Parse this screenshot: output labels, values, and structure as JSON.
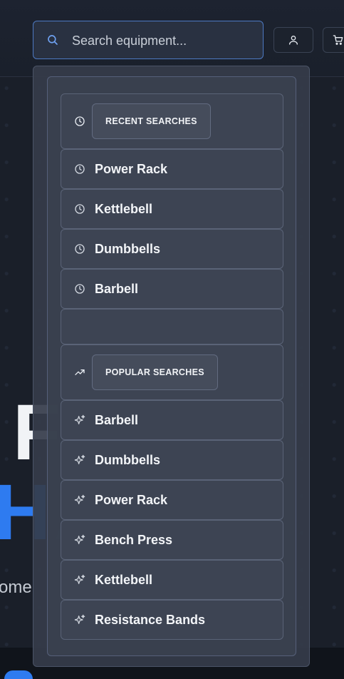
{
  "search": {
    "placeholder": "Search equipment..."
  },
  "hero": {
    "line1": "FT",
    "line2": "HA",
    "subtitle": "ome"
  },
  "recent": {
    "title": "RECENT SEARCHES",
    "items": [
      "Power Rack",
      "Kettlebell",
      "Dumbbells",
      "Barbell"
    ]
  },
  "popular": {
    "title": "POPULAR SEARCHES",
    "items": [
      "Barbell",
      "Dumbbells",
      "Power Rack",
      "Bench Press",
      "Kettlebell",
      "Resistance Bands"
    ]
  },
  "icons": {
    "search": "search-icon",
    "account": "user-icon",
    "cart": "cart-icon",
    "recent": "clock-icon",
    "popular": "trending-up-icon",
    "popular_item": "sparkles-icon"
  },
  "colors": {
    "accent": "#2e7bf0",
    "background": "#141922",
    "dropdown": "#3d4453"
  }
}
